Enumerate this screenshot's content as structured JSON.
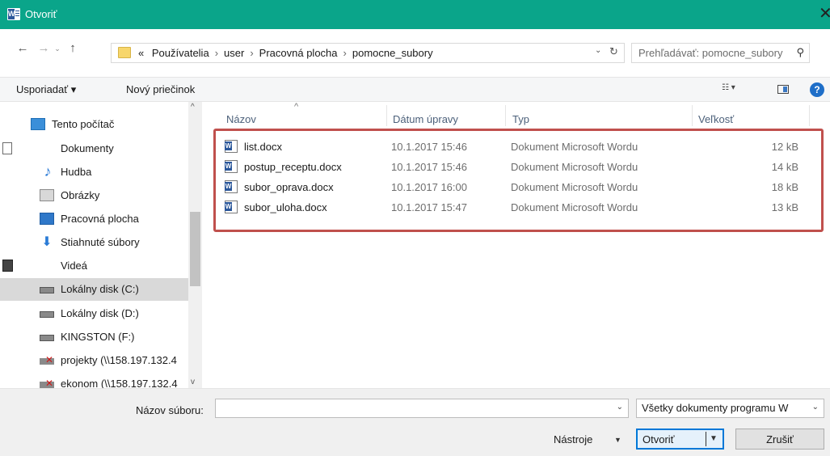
{
  "window": {
    "title": "Otvoriť",
    "close_glyph": "✕"
  },
  "navigation": {
    "back_glyph": "←",
    "forward_glyph": "→",
    "recent_glyph": "⌄",
    "up_glyph": "↑",
    "breadcrumb": [
      "«",
      "Používatelia",
      "user",
      "Pracovná plocha",
      "pomocne_subory"
    ],
    "separator": "›",
    "dropdown_glyph": "⌄",
    "refresh_glyph": "↻",
    "search_placeholder": "Prehľadávať: pomocne_subory",
    "search_glyph": "⚲"
  },
  "toolbar": {
    "organize_label": "Usporiadať ▾",
    "new_folder_label": "Nový priečinok",
    "view_glyph": "☷ ▾",
    "help_glyph": "?"
  },
  "sidebar": {
    "items": [
      {
        "label": "Tento počítač",
        "icon": "computer-icon"
      },
      {
        "label": "Dokumenty",
        "icon": "documents-icon"
      },
      {
        "label": "Hudba",
        "icon": "music-icon"
      },
      {
        "label": "Obrázky",
        "icon": "pictures-icon"
      },
      {
        "label": "Pracovná plocha",
        "icon": "desktop-icon"
      },
      {
        "label": "Stiahnuté súbory",
        "icon": "downloads-icon"
      },
      {
        "label": "Videá",
        "icon": "videos-icon"
      },
      {
        "label": "Lokálny disk (C:)",
        "icon": "drive-icon",
        "selected": true
      },
      {
        "label": "Lokálny disk (D:)",
        "icon": "drive-icon"
      },
      {
        "label": "KINGSTON (F:)",
        "icon": "usb-drive-icon"
      },
      {
        "label": "projekty (\\\\158.197.132.4",
        "icon": "network-drive-icon"
      },
      {
        "label": "ekonom (\\\\158.197.132.4",
        "icon": "network-drive-icon"
      }
    ],
    "scroll_up_glyph": "^",
    "scroll_down_glyph": "v"
  },
  "file_list": {
    "columns": {
      "name": "Názov",
      "date": "Dátum úpravy",
      "type": "Typ",
      "size": "Veľkosť"
    },
    "sort_glyph": "^",
    "rows": [
      {
        "name": "list.docx",
        "date": "10.1.2017 15:46",
        "type": "Dokument Microsoft Wordu",
        "size": "12 kB"
      },
      {
        "name": "postup_receptu.docx",
        "date": "10.1.2017 15:46",
        "type": "Dokument Microsoft Wordu",
        "size": "14 kB"
      },
      {
        "name": "subor_oprava.docx",
        "date": "10.1.2017 16:00",
        "type": "Dokument Microsoft Wordu",
        "size": "18 kB"
      },
      {
        "name": "subor_uloha.docx",
        "date": "10.1.2017 15:47",
        "type": "Dokument Microsoft Wordu",
        "size": "13 kB"
      }
    ]
  },
  "footer": {
    "filename_label": "Názov súboru:",
    "filename_value": "",
    "filename_dropdown_glyph": "⌄",
    "filter_value": "Všetky dokumenty programu W",
    "filter_dropdown_glyph": "⌄",
    "tools_label": "Nástroje",
    "tools_arrow": "▼",
    "open_label": "Otvoriť",
    "open_arrow": "▼",
    "cancel_label": "Zrušiť"
  },
  "colors": {
    "titlebar": "#0aa58a",
    "highlight_border": "#c0504d",
    "accent": "#0078d7"
  }
}
